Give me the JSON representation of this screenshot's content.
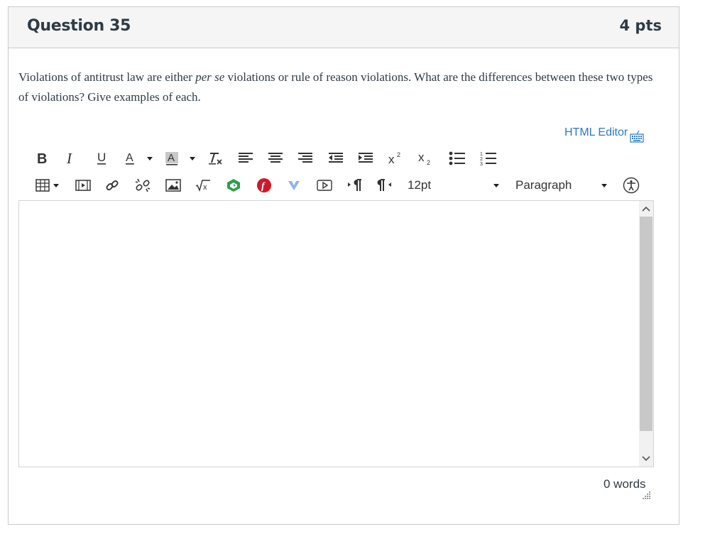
{
  "question": {
    "title": "Question 35",
    "points": "4 pts",
    "text_before": "Violations of antitrust law are either ",
    "text_emph": "per se",
    "text_after": " violations or rule of reason violations. What are the differences between these two types of violations? Give examples of each."
  },
  "editor": {
    "html_editor_link": "HTML Editor",
    "toolbar_row1": [
      "bold-icon",
      "italic-icon",
      "underline-icon",
      "text-color-icon",
      "background-color-icon",
      "clear-formatting-icon",
      "align-left-icon",
      "align-center-icon",
      "align-right-icon",
      "outdent-icon",
      "indent-icon",
      "superscript-icon",
      "subscript-icon",
      "bullet-list-icon",
      "numbered-list-icon"
    ],
    "toolbar_row2": [
      "table-icon",
      "media-icon",
      "link-icon",
      "unlink-icon",
      "image-icon",
      "equation-icon",
      "office365-icon",
      "flickr-icon",
      "vimeo-icon",
      "embed-icon",
      "ltr-icon",
      "rtl-icon"
    ],
    "font_size": "12pt",
    "block_format": "Paragraph",
    "word_count": "0 words"
  },
  "colors": {
    "link": "#2b7abc",
    "text": "#2d3b45",
    "header_bg": "#f5f5f5",
    "border": "#c7cdd1"
  }
}
